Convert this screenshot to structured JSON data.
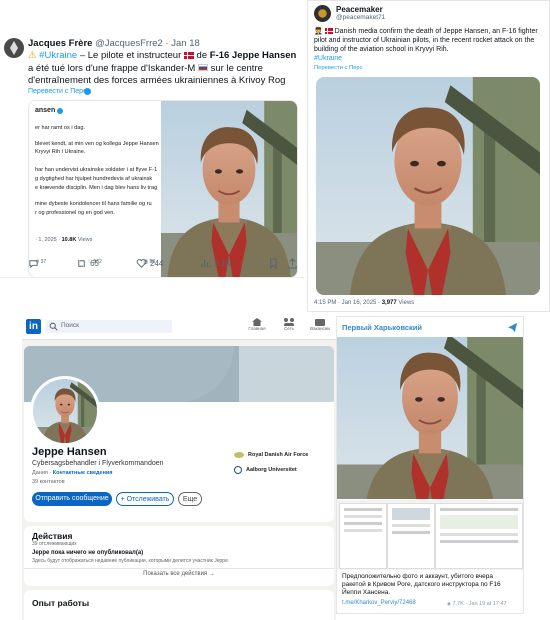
{
  "tweet1": {
    "author_name": "Jacques Frère",
    "handle": "@JacquesFrre2",
    "date": "· Jan 18",
    "text_hashtag": "#Ukraine",
    "text_part1": " – Le pilote et instructeur",
    "text_part2": " de ",
    "text_bold": "F-16 Jeppe Hansen",
    "text_part3": " a été tué lors d'une frappe d'Iskander-M",
    "text_part4": " sur le centre d'entraînement des forces armées ukrainiennes à Krivoy Rog",
    "translate_label": "Перевести с Перс",
    "embedded": {
      "name_fragment": "ansen",
      "line1": "er har ramt os i dag.",
      "line2": "blevet kendt, at min ven og kollega Jeppe Hansen",
      "line3": "Kryvyi Rih i Ukraine.",
      "line4": "har han undervist ukrainske soldater i at flyve F-1",
      "line5": "g dygtighed har hjulpet hundredevis af ukrainsk",
      "line6": "e krævende disciplin. Men i dag blev hans liv trag",
      "line7": "mine dybeste kondolencer til hans familie og ru",
      "line8": "r og professionel og en god ven.",
      "timestamp": "· 1, 2025 · ",
      "views": "10.8K",
      "views_label": " Views",
      "stat_replies": "37",
      "stat_retweets": "562",
      "stat_likes": "58"
    },
    "stats": {
      "retweets": "65",
      "likes": "244",
      "views": "5.1K"
    }
  },
  "tweet2": {
    "author_name": "Peacemaker",
    "handle": "@peacemaket71",
    "text": "Danish media confirm the death of Jeppe Hansen, an F-16 fighter pilot and instructor of Ukrainian pilots, in the recent rocket attack on the building of the aviation school in Kryvyi Rih.",
    "hashtag": "#Ukraine",
    "translate_label": "Перевести с Перс",
    "time": "4:15 PM · Jan 16, 2025 · ",
    "views": "3,977",
    "views_label": " Views"
  },
  "linkedin": {
    "logo": "in",
    "search_placeholder": "Поиск",
    "nav": [
      "Главная",
      "Сеть",
      "Вакансии"
    ],
    "name": "Jeppe Hansen",
    "headline": "Cybersagsbehandler i Flyverkommandoen",
    "location": "Дания",
    "contact_info": "Контактные сведения",
    "connections": "39 контактов",
    "btn_message": "Отправить сообщение",
    "btn_follow": "+ Отслеживать",
    "btn_more": "Еще",
    "org1": "Royal Danish Air Force",
    "org2": "Aalborg Universitet",
    "activity_title": "Действия",
    "followers": "39 отслеживающих",
    "no_posts": "Jeppe пока ничего не опубликовал(а)",
    "no_posts_sub": "Здесь будут отображаться недавние публикации, которыми делится участник Jeppe.",
    "show_all": "Показать все действия",
    "show_all_arrow": "→",
    "experience_title": "Опыт работы"
  },
  "telegram": {
    "channel": "Первый Харьковский",
    "text": "Предположительно фото и аккаунт, убитого вчера ракетой в Кривом Роге, датского инструктора по F16 Йеппи Хансена.",
    "link": "t.me/Kharkov_Perviy/72468",
    "views": "7.7K",
    "time": "Jan 19 at 17:47",
    "eye": "👁"
  },
  "icons": [
    "bulb-icon",
    "warning-icon",
    "retweet-icon",
    "heart-icon",
    "views-icon",
    "bookmark-icon",
    "share-icon",
    "verified-icon",
    "telegram-icon",
    "search-icon",
    "home-icon",
    "network-icon",
    "jobs-icon"
  ],
  "colors": {
    "twitter_blue": "#1d9bf0",
    "linkedin_blue": "#0a66c2",
    "telegram_blue": "#2f8bd0"
  }
}
